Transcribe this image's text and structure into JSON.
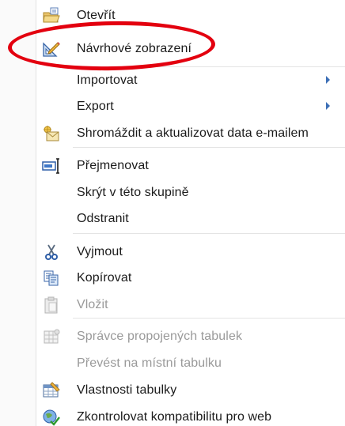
{
  "menu": {
    "items": [
      {
        "label": "Otevřít",
        "icon": "open-folder-icon",
        "enabled": true,
        "submenu": false
      },
      {
        "label": "Návrhové zobrazení",
        "icon": "design-view-icon",
        "enabled": true,
        "submenu": false
      },
      {
        "label": "Importovat",
        "icon": "",
        "enabled": true,
        "submenu": true
      },
      {
        "label": "Export",
        "icon": "",
        "enabled": true,
        "submenu": true
      },
      {
        "label": "Shromáždit a aktualizovat data e-mailem",
        "icon": "collect-email-data-icon",
        "enabled": true,
        "submenu": false
      },
      {
        "label": "Přejmenovat",
        "icon": "rename-icon",
        "enabled": true,
        "submenu": false
      },
      {
        "label": "Skrýt v této skupině",
        "icon": "",
        "enabled": true,
        "submenu": false
      },
      {
        "label": "Odstranit",
        "icon": "",
        "enabled": true,
        "submenu": false
      },
      {
        "label": "Vyjmout",
        "icon": "scissors-icon",
        "enabled": true,
        "submenu": false
      },
      {
        "label": "Kopírovat",
        "icon": "copy-icon",
        "enabled": true,
        "submenu": false
      },
      {
        "label": "Vložit",
        "icon": "paste-icon",
        "enabled": false,
        "submenu": false
      },
      {
        "label": "Správce propojených tabulek",
        "icon": "linked-table-manager-icon",
        "enabled": false,
        "submenu": false
      },
      {
        "label": "Převést na místní tabulku",
        "icon": "",
        "enabled": false,
        "submenu": false
      },
      {
        "label": "Vlastnosti tabulky",
        "icon": "table-properties-icon",
        "enabled": true,
        "submenu": false
      },
      {
        "label": "Zkontrolovat kompatibilitu pro web",
        "icon": "web-compatibility-check-icon",
        "enabled": true,
        "submenu": false
      }
    ]
  },
  "annotation": {
    "highlighted_item": "Návrhové zobrazení",
    "color": "#e3000f"
  },
  "colors": {
    "submenu_arrow": "#3c6fb6",
    "disabled_text": "#9a9a9a"
  }
}
